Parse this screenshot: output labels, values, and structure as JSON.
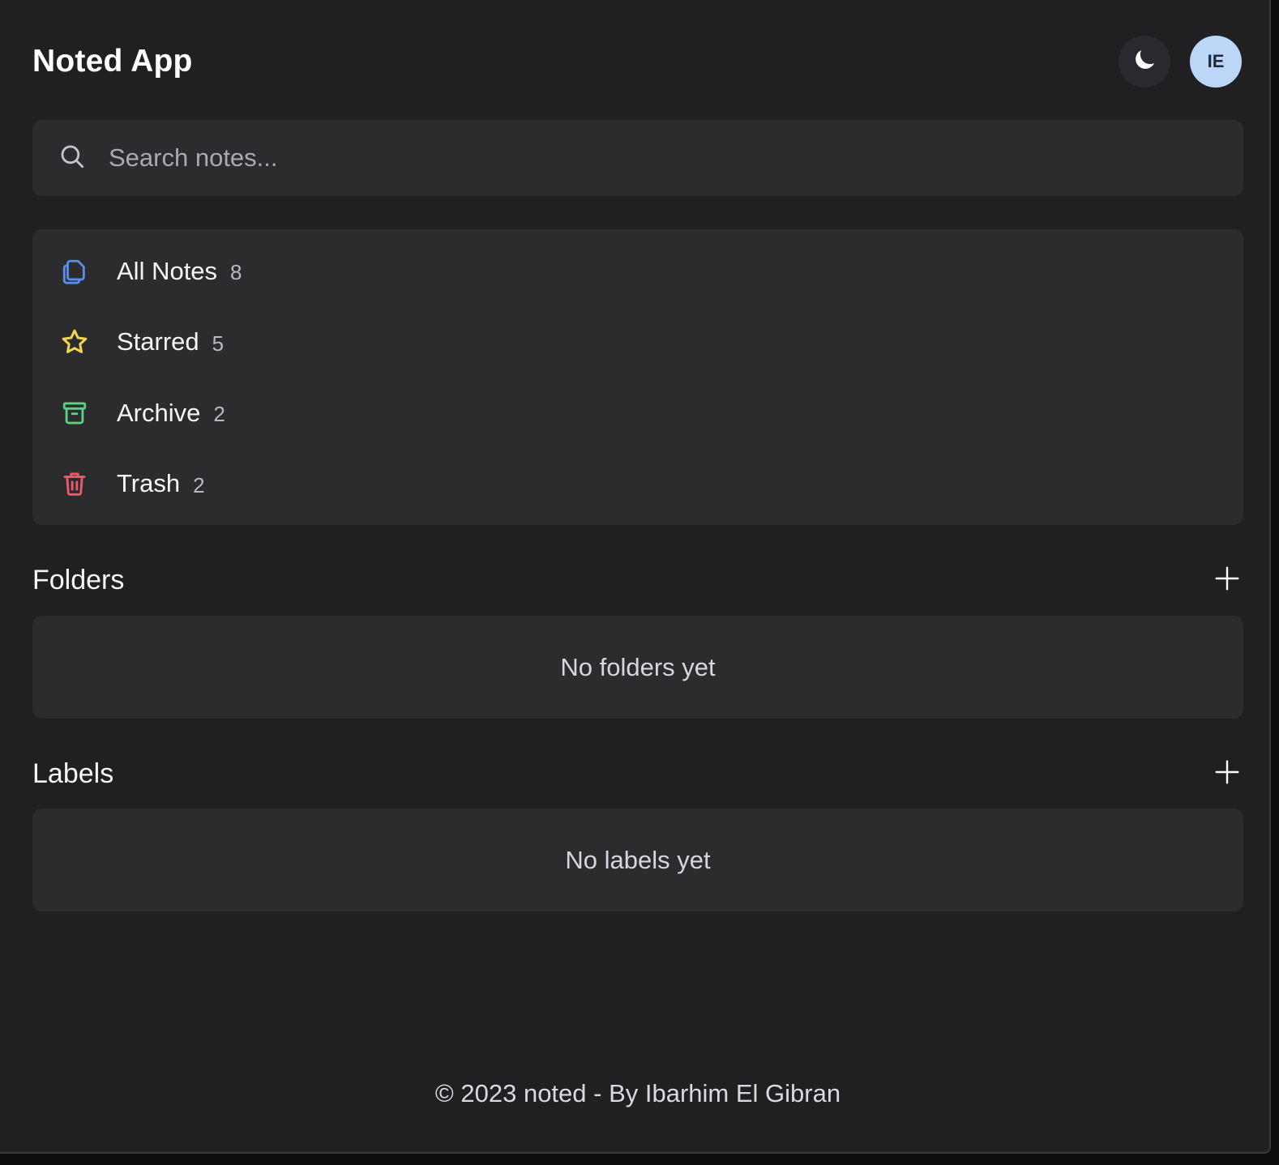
{
  "header": {
    "title": "Noted App",
    "theme_toggle_icon": "moon-icon",
    "avatar_initials": "IE"
  },
  "search": {
    "placeholder": "Search notes...",
    "value": "",
    "icon": "search-icon"
  },
  "nav": {
    "items": [
      {
        "label": "All Notes",
        "count": "8",
        "icon": "copy-notes-icon",
        "color": "#5b8def"
      },
      {
        "label": "Starred",
        "count": "5",
        "icon": "star-icon",
        "color": "#f2d64b"
      },
      {
        "label": "Archive",
        "count": "2",
        "icon": "archive-icon",
        "color": "#5ecf87"
      },
      {
        "label": "Trash",
        "count": "2",
        "icon": "trash-icon",
        "color": "#ef5a6a"
      }
    ]
  },
  "folders": {
    "title": "Folders",
    "add_icon": "plus-icon",
    "empty_text": "No folders yet"
  },
  "labels": {
    "title": "Labels",
    "add_icon": "plus-icon",
    "empty_text": "No labels yet"
  },
  "footer": {
    "text": "© 2023 noted - By Ibarhim El Gibran"
  },
  "colors": {
    "background": "#202023",
    "card": "#2c2c2f",
    "avatar_bg": "#bcd6f7"
  }
}
